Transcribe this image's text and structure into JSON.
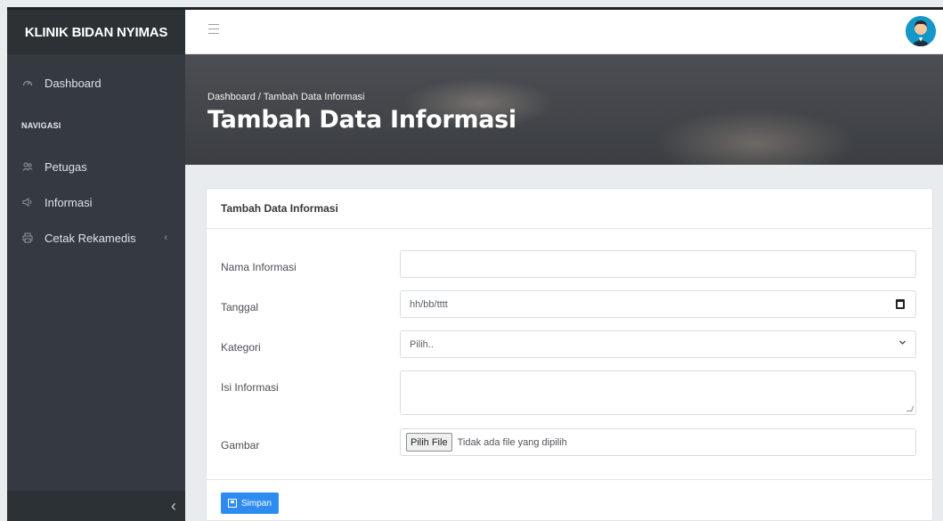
{
  "sidebar": {
    "brand": "KLINIK BIDAN NYIMAS",
    "dashboard": {
      "label": "Dashboard",
      "icon": "dashboard-icon"
    },
    "section_header": "NAVIGASI",
    "items": [
      {
        "label": "Petugas",
        "icon": "users-icon"
      },
      {
        "label": "Informasi",
        "icon": "megaphone-icon"
      },
      {
        "label": "Cetak Rekamedis",
        "icon": "printer-icon",
        "arrow": "‹"
      }
    ],
    "collapse_icon": "‹"
  },
  "topbar": {
    "menu_icon": "hamburger-icon",
    "avatar_icon": "user-avatar-icon"
  },
  "hero": {
    "breadcrumb": "Dashboard / Tambah Data Informasi",
    "title": "Tambah Data Informasi"
  },
  "form": {
    "card_title": "Tambah Data Informasi",
    "fields": {
      "nama": {
        "label": "Nama Informasi",
        "value": ""
      },
      "tanggal": {
        "label": "Tanggal",
        "value": "hh/bb/tttt"
      },
      "kategori": {
        "label": "Kategori",
        "value": "Pilih.."
      },
      "isi": {
        "label": "Isi Informasi",
        "value": ""
      },
      "gambar": {
        "label": "Gambar",
        "button": "Pilih File",
        "status": "Tidak ada file yang dipilih"
      }
    },
    "submit": "Simpan"
  },
  "colors": {
    "sidebar": "#343a40",
    "accent": "#2e8cf0"
  }
}
